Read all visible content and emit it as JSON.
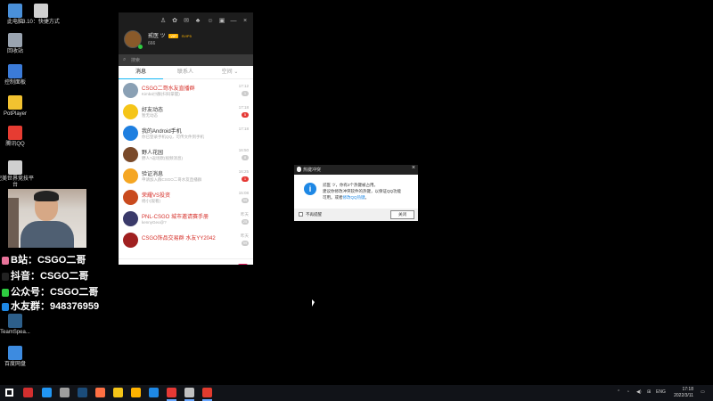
{
  "desktop": {
    "icons": [
      {
        "label": "此电脑",
        "color": "#4a90d9"
      },
      {
        "label": "3.10：快捷方式",
        "color": "#d0d0d0"
      },
      {
        "label": "回收站",
        "color": "#9aa4b0"
      },
      {
        "label": "控制面板",
        "color": "#3b7bd8"
      },
      {
        "label": "PotPlayer",
        "color": "#f2c230"
      },
      {
        "label": "腾讯QQ",
        "color": "#e63c32"
      },
      {
        "label": "完美世界竞技平台",
        "color": "#cfcfcf"
      },
      {
        "label": "TeamSpea...",
        "color": "#2d5f8a"
      },
      {
        "label": "百度网盘",
        "color": "#3d8be0"
      }
    ]
  },
  "qq": {
    "title_icons": [
      "pin-icon",
      "skin-icon",
      "mail-icon",
      "game-icon",
      "qzone-icon",
      "message-icon",
      "minimize-icon",
      "close-icon"
    ],
    "nickname": "贰医 ツ",
    "badge": "VIP",
    "svip": "SVIP5",
    "signature": "666",
    "search_placeholder": "搜索",
    "tabs": [
      "消息",
      "联系人",
      "空间"
    ],
    "conversations": [
      {
        "name": "CSGO二哥水友直播群",
        "preview": "Kimba\u0001群(扫码掌握)",
        "time": "17:12",
        "count": "1",
        "name_color": "#d6322c",
        "avatar_color": "#8aa0b4",
        "count_red": false
      },
      {
        "name": "好友动态",
        "preview": "暂无动态",
        "time": "17:18",
        "count": "5",
        "name_color": "#333333",
        "avatar_color": "#f5c518",
        "count_red": true
      },
      {
        "name": "我的Android手机",
        "preview": "你已登录手机QQ，可传文件到手机",
        "time": "17:18",
        "count": "",
        "name_color": "#333333",
        "avatar_color": "#1e7fe0",
        "count_red": false
      },
      {
        "name": "野人花园",
        "preview": "野人?返场默(视频消息)",
        "time": "16:50",
        "count": "8",
        "name_color": "#333333",
        "avatar_color": "#7a4a2a",
        "count_red": false
      },
      {
        "name": "验证消息",
        "preview": "申请加入群CSGO二哥水友直播群",
        "time": "16:25",
        "count": "1",
        "name_color": "#333333",
        "avatar_color": "#f5a623",
        "count_red": true
      },
      {
        "name": "荣耀VS投资",
        "preview": "杨小(观看)",
        "time": "15:08",
        "count": "99",
        "name_color": "#d6322c",
        "avatar_color": "#c94a1e",
        "count_red": false
      },
      {
        "name": "PNL-CSGO 城市邀请赛手册",
        "preview": "kennyGeo@?",
        "time": "昨天",
        "count": "25",
        "name_color": "#d6322c",
        "avatar_color": "#3a3a6a",
        "count_red": false
      },
      {
        "name": "CSGO饰品交易群 水友YY2042",
        "preview": "",
        "time": "昨天",
        "count": "99",
        "name_color": "#d6322c",
        "avatar_color": "#a02020",
        "count_red": false
      }
    ],
    "bottom_icons": [
      "menu-icon",
      "contacts-icon",
      "apps-icon",
      "game-assistant-icon",
      "gift-icon"
    ]
  },
  "dialog": {
    "title": "热键冲突",
    "line1": "贰医 ツ，你有2个热键被占用。",
    "line2": "建议你修改冲突软件的热键，以保证QQ功能",
    "line3_prefix": "可用。或者",
    "line3_link": "修改QQ热键",
    "line3_suffix": "。",
    "checkbox_label": "不再提醒",
    "button_label": "关闭"
  },
  "stream_overlay": [
    {
      "text": "B站：CSGO二哥",
      "color": "#e8739a"
    },
    {
      "text": "抖音：CSGO二哥",
      "color": "#222222"
    },
    {
      "text": "公众号：CSGO二哥",
      "color": "#2ecc40"
    },
    {
      "text": "水友群：948376959",
      "color": "#1e88e5"
    }
  ],
  "taskbar": {
    "apps": [
      {
        "name": "windows",
        "color": "#ffffff"
      },
      {
        "name": "live-app",
        "color": "#d32f2f"
      },
      {
        "name": "browser-app",
        "color": "#2196f3"
      },
      {
        "name": "store-app",
        "color": "#9e9e9e"
      },
      {
        "name": "steam-app",
        "color": "#1b4c7a"
      },
      {
        "name": "firefox-app",
        "color": "#ff7043"
      },
      {
        "name": "explorer-app",
        "color": "#f5c518"
      },
      {
        "name": "potplayer-app",
        "color": "#ffb300"
      },
      {
        "name": "teamspeak-app",
        "color": "#1e88e5"
      },
      {
        "name": "game-app",
        "color": "#e53935"
      },
      {
        "name": "perfect-world-app",
        "color": "#c0c0c0"
      },
      {
        "name": "qq-app",
        "color": "#e23b2e"
      }
    ],
    "tray_lang": "ENG",
    "time": "17:18",
    "date": "2022/3/11"
  }
}
